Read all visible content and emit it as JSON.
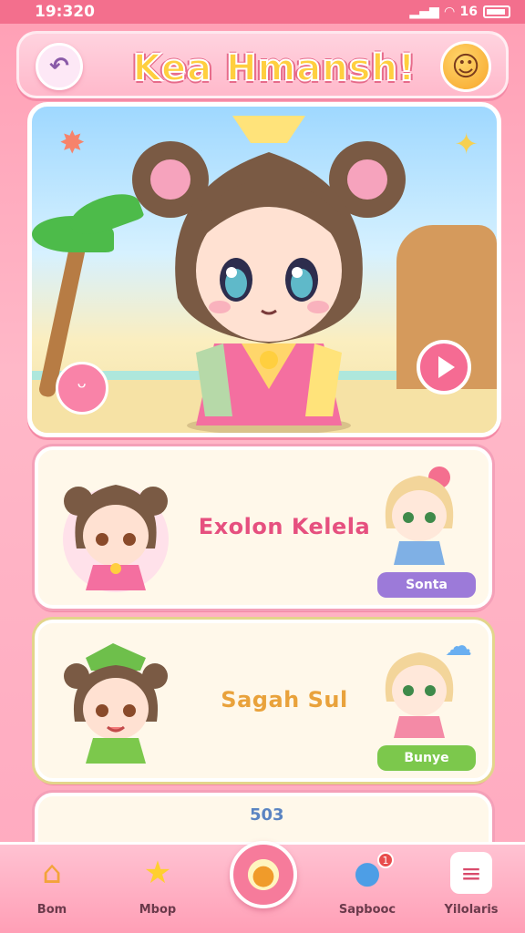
{
  "status_bar": {
    "time": "19:320",
    "battery": "16"
  },
  "header": {
    "title": "Kea Hmansh!"
  },
  "hero": {
    "emblem_icon": "grin-icon",
    "play_icon": "play-icon"
  },
  "cards": [
    {
      "title": "Exolon Kelela",
      "badge": "Sonta"
    },
    {
      "title": "Sagah Sul",
      "badge": "Bunye"
    },
    {
      "label": "503"
    }
  ],
  "nav": {
    "items": [
      {
        "label": "Bom",
        "icon": "house-icon"
      },
      {
        "label": "Mbop",
        "icon": "star-icon"
      },
      {
        "label": "Sapbooc",
        "icon": "blob-icon",
        "badge": "1"
      },
      {
        "label": "Yilolaris",
        "icon": "menu-icon"
      }
    ]
  },
  "colors": {
    "primary": "#f56b93",
    "card1_badge": "#9c7ad9",
    "card2_badge": "#7cc84c"
  }
}
